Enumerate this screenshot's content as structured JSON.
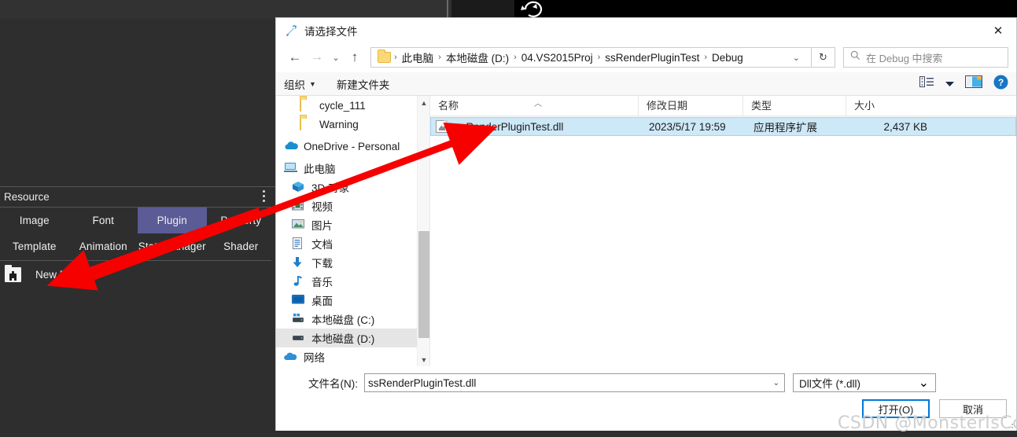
{
  "resource_panel": {
    "title": "Resource",
    "menu_icon": "kebab-menu-icon",
    "tabs_row1": [
      {
        "label": "Image",
        "active": false
      },
      {
        "label": "Font",
        "active": false
      },
      {
        "label": "Plugin",
        "active": true
      },
      {
        "label": "Property",
        "active": false
      }
    ],
    "tabs_row2": [
      {
        "label": "Template",
        "active": false
      },
      {
        "label": "Animation",
        "active": false
      },
      {
        "label": "StateManager",
        "active": false
      },
      {
        "label": "Shader",
        "active": false
      }
    ],
    "new_item": {
      "label": "New Plugin",
      "icon": "add-folder-icon"
    },
    "accent_color": "#5b5b96",
    "background_color": "#2e2e2e"
  },
  "dialog": {
    "title": "请选择文件",
    "title_icon": "rocket-icon",
    "close_icon": "close-icon",
    "nav": {
      "back_icon": "arrow-left-icon",
      "forward_icon": "arrow-right-icon",
      "recent_icon": "chevron-down-icon",
      "up_icon": "arrow-up-icon",
      "folder_icon": "folder-icon",
      "breadcrumbs": [
        "此电脑",
        "本地磁盘 (D:)",
        "04.VS2015Proj",
        "ssRenderPluginTest",
        "Debug"
      ],
      "breadcrumb_caret": "chevron-down-icon",
      "refresh_icon": "refresh-icon"
    },
    "search": {
      "icon": "search-icon",
      "placeholder": "在 Debug 中搜索"
    },
    "toolbar": {
      "organize": "组织",
      "organize_caret": "chevron-down-icon",
      "new_folder": "新建文件夹",
      "view_icon": "view-list-icon",
      "view_caret": "chevron-down-icon",
      "preview_pane_icon": "preview-pane-icon",
      "help_icon": "help-icon"
    },
    "tree": {
      "items": [
        {
          "label": "cycle_111",
          "icon": "folder-icon",
          "indent": 1,
          "selected": false
        },
        {
          "label": "Warning",
          "icon": "folder-icon",
          "indent": 1,
          "selected": false
        },
        {
          "label": "OneDrive - Personal",
          "icon": "onedrive-icon",
          "indent": 0,
          "selected": false
        },
        {
          "label": "此电脑",
          "icon": "this-pc-icon",
          "indent": 0,
          "selected": false
        },
        {
          "label": "3D 对象",
          "icon": "3d-objects-icon",
          "indent": 2,
          "selected": false
        },
        {
          "label": "视频",
          "icon": "videos-icon",
          "indent": 2,
          "selected": false
        },
        {
          "label": "图片",
          "icon": "pictures-icon",
          "indent": 2,
          "selected": false
        },
        {
          "label": "文档",
          "icon": "documents-icon",
          "indent": 2,
          "selected": false
        },
        {
          "label": "下载",
          "icon": "downloads-icon",
          "indent": 2,
          "selected": false
        },
        {
          "label": "音乐",
          "icon": "music-icon",
          "indent": 2,
          "selected": false
        },
        {
          "label": "桌面",
          "icon": "desktop-icon",
          "indent": 2,
          "selected": false
        },
        {
          "label": "本地磁盘 (C:)",
          "icon": "drive-icon",
          "indent": 2,
          "selected": false
        },
        {
          "label": "本地磁盘 (D:)",
          "icon": "drive-icon",
          "indent": 2,
          "selected": true
        },
        {
          "label": "网络",
          "icon": "network-icon",
          "indent": 0,
          "selected": false
        }
      ],
      "scroll_up_icon": "chevron-up-icon",
      "scroll_down_icon": "chevron-down-icon"
    },
    "file_list": {
      "columns": [
        "名称",
        "修改日期",
        "类型",
        "大小"
      ],
      "sort_indicator": "chevron-up-icon",
      "rows": [
        {
          "name": "ssRenderPluginTest.dll",
          "icon": "dll-file-icon",
          "modified": "2023/5/17 19:59",
          "type": "应用程序扩展",
          "size": "2,437 KB",
          "selected": true
        }
      ]
    },
    "footer": {
      "file_name_label": "文件名(N):",
      "file_name_value": "ssRenderPluginTest.dll",
      "file_name_caret": "chevron-down-icon",
      "file_type_value": "Dll文件 (*.dll)",
      "file_type_caret": "chevron-down-icon",
      "open_button": "打开(O)",
      "cancel_button": "取消",
      "primary_color": "#0078d7"
    }
  },
  "annotations": {
    "arrow_color": "#f60000",
    "arrows": [
      {
        "name": "arrow-new-plugin-to-file"
      },
      {
        "name": "arrow-plugin-tab-to-new-plugin"
      }
    ]
  },
  "watermark": {
    "text": "CSDN @MonsterIsCool"
  }
}
